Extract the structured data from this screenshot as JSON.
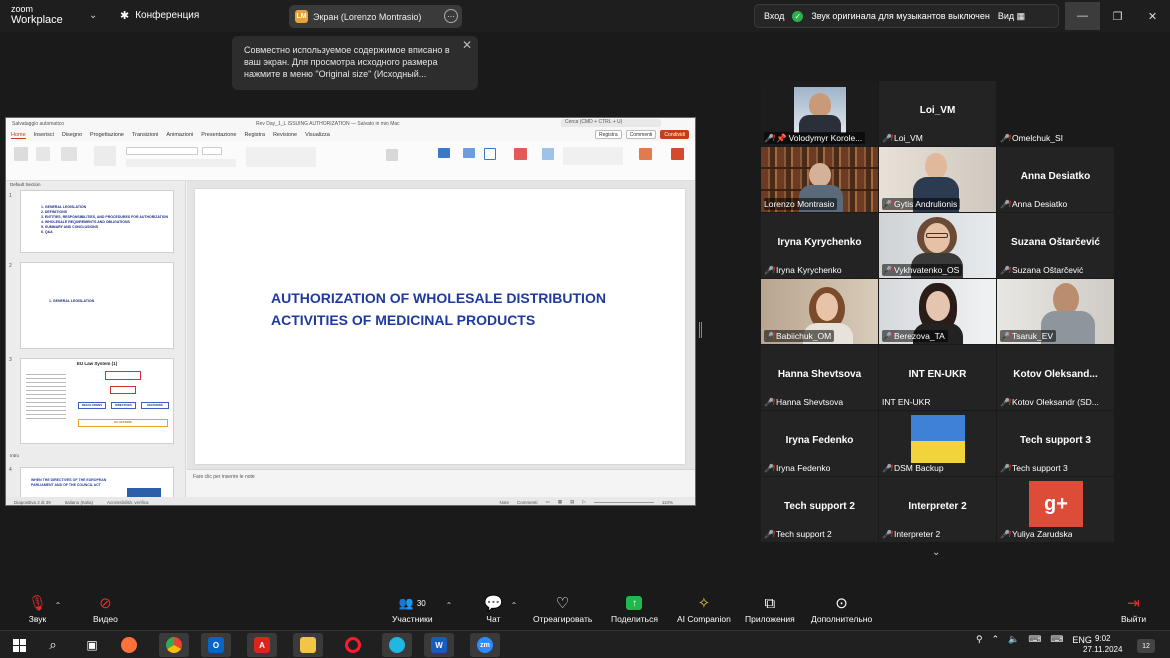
{
  "titlebar": {
    "brand_line1": "zoom",
    "brand_line2": "Workplace",
    "conference_label": "Конференция",
    "screen_share_label": "Экран (Lorenzo Montrasio)",
    "screen_share_initials": "LM",
    "login_label": "Вход",
    "original_sound_label": "Звук оригинала для музыкантов выключен",
    "view_label": "Вид"
  },
  "tooltip": {
    "text": "Совместно используемое содержимое вписано в ваш экран. Для просмотра исходного размера нажмите в меню \"Original size\" (Исходный..."
  },
  "powerpoint": {
    "autosave_label": "Salvataggio automatico",
    "file_title": "Rev Day_1_L ISSUING AUTHORIZATION — Salvato in mio Mac",
    "search_placeholder": "Cerca (CMD + CTRL + U)",
    "menu": [
      "Home",
      "Inserisci",
      "Disegno",
      "Progettazione",
      "Transizioni",
      "Animazioni",
      "Presentazione",
      "Registra",
      "Revisione",
      "Visualizza"
    ],
    "record_label": "Registra",
    "comments_label": "Commenti",
    "share_label": "Condividi",
    "section_default": "Default Section",
    "section_intro": "Intro",
    "thumb1_lines": [
      "1. GENERAL LEGISLATION",
      "2. DEFINITIONS",
      "3. ENTITIES, RESPONSIBILITIES, AND PROCEDURES FOR AUTHORIZATION",
      "4. WHOLESALE REQUIREMENTS AND OBLIGATIONS",
      "5. SUMMARY AND CONCLUSIONS",
      "6. Q&A"
    ],
    "thumb2_text": "1. GENERAL LEGISLATION",
    "thumb3_title": "EU Law System (1)",
    "thumb3_box_left": "REGULATIONS",
    "thumb3_box_mid": "DIRECTIVES",
    "thumb3_box_right": "DECISIONS",
    "thumb3_bottom": "EU ACTIONS",
    "thumb4_text": "WHEN THE DIRECTIVES OF THE EUROPEAN PARLIAMENT AND OF THE COUNCIL ACT",
    "slide_title": "AUTHORIZATION OF WHOLESALE DISTRIBUTION ACTIVITIES OF MEDICINAL PRODUCTS",
    "notes_placeholder": "Fare clic per inserire le note",
    "status_slide": "Diapositiva 2 di 39",
    "status_lang": "Italiano (Italia)",
    "status_access": "Accessibilità: verifica",
    "status_notes": "Note",
    "status_comments": "Commenti",
    "zoom_level": "110%"
  },
  "gallery": {
    "tiles": [
      {
        "name": "Volodymyr Korole...",
        "center": "",
        "video": "man-suit"
      },
      {
        "name": "Loi_VM",
        "center": "Loi_VM",
        "video": ""
      },
      {
        "name": "Omelchuk_SI",
        "center": "",
        "video": ""
      },
      {
        "name": "Lorenzo Montrasio",
        "center": "",
        "video": "bookshelf"
      },
      {
        "name": "Gytis Andrulionis",
        "center": "",
        "video": "man-office"
      },
      {
        "name": "Anna Desiatko",
        "center": "Anna Desiatko",
        "video": ""
      },
      {
        "name": "Iryna Kyrychenko",
        "center": "Iryna Kyrychenko",
        "video": ""
      },
      {
        "name": "Vykhvatenko_OS",
        "center": "",
        "video": "woman-glasses"
      },
      {
        "name": "Suzana Oštarčević",
        "center": "Suzana Oštarčević",
        "video": ""
      },
      {
        "name": "Babiichuk_OM",
        "center": "",
        "video": "woman-smile"
      },
      {
        "name": "Berezova_TA",
        "center": "",
        "video": "woman-dark"
      },
      {
        "name": "Tsaruk_EV",
        "center": "",
        "video": "man-grey"
      },
      {
        "name": "Hanna Shevtsova",
        "center": "Hanna Shevtsova",
        "video": ""
      },
      {
        "name": "INT EN-UKR",
        "center": "INT EN-UKR",
        "video": ""
      },
      {
        "name": "Kotov Oleksandr (SD...",
        "center": "Kotov  Oleksand...",
        "video": ""
      },
      {
        "name": "Iryna Fedenko",
        "center": "Iryna Fedenko",
        "video": ""
      },
      {
        "name": "DSM Backup",
        "center": "",
        "video": "flag"
      },
      {
        "name": "Tech support 3",
        "center": "Tech support 3",
        "video": ""
      },
      {
        "name": "Tech support 2",
        "center": "Tech support 2",
        "video": ""
      },
      {
        "name": "Interpreter 2",
        "center": "Interpreter 2",
        "video": ""
      },
      {
        "name": "Yuliya Zarudska",
        "center": "",
        "video": "gplus"
      }
    ]
  },
  "toolbar": {
    "audio": "Звук",
    "video": "Видео",
    "participants": "Участники",
    "participants_count": "30",
    "chat": "Чат",
    "react": "Отреагировать",
    "share": "Поделиться",
    "ai": "AI Companion",
    "apps": "Приложения",
    "more": "Дополнительно",
    "leave": "Выйти"
  },
  "taskbar": {
    "lang": "ENG",
    "time": "9:02",
    "date": "27.11.2024",
    "notifications": "12"
  },
  "colors": {
    "accent_red": "#e03131",
    "active_speaker": "#27c27a",
    "slide_title": "#1f3a9e",
    "share_green": "#1fb84f"
  }
}
